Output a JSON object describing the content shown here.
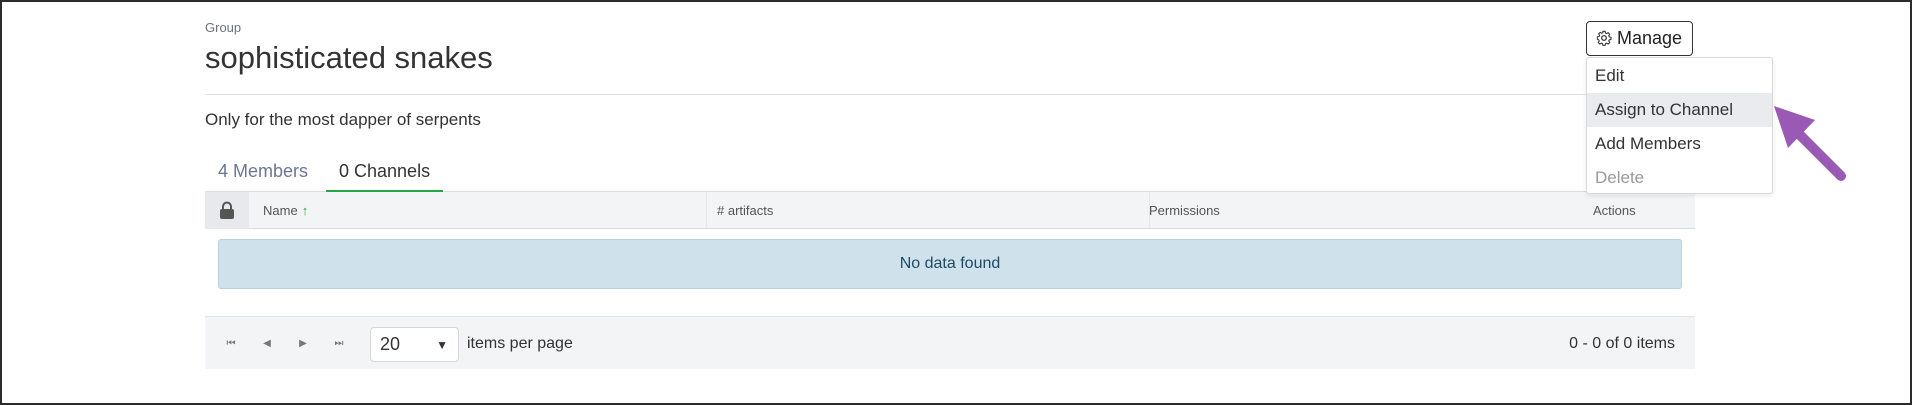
{
  "header": {
    "kicker": "Group",
    "title": "sophisticated snakes",
    "description": "Only for the most dapper of serpents"
  },
  "manage": {
    "label": "Manage",
    "menu": [
      {
        "label": "Edit",
        "enabled": true
      },
      {
        "label": "Assign to Channel",
        "enabled": true,
        "highlighted": true
      },
      {
        "label": "Add Members",
        "enabled": true
      },
      {
        "label": "Delete",
        "enabled": false
      }
    ]
  },
  "tabs": [
    {
      "label": "4 Members",
      "active": false
    },
    {
      "label": "0 Channels",
      "active": true
    }
  ],
  "grid": {
    "columns": [
      "Name",
      "# artifacts",
      "Permissions",
      "Actions"
    ],
    "sorted_column": "Name",
    "sort_direction": "ascending",
    "empty_message": "No data found"
  },
  "pager": {
    "page_size": "20",
    "items_per_page_label": "items per page",
    "info": "0 - 0 of 0 items"
  },
  "colors": {
    "accent_green": "#28a745",
    "empty_bg": "#cfe2ec",
    "annotation_arrow": "#9b59b6"
  }
}
